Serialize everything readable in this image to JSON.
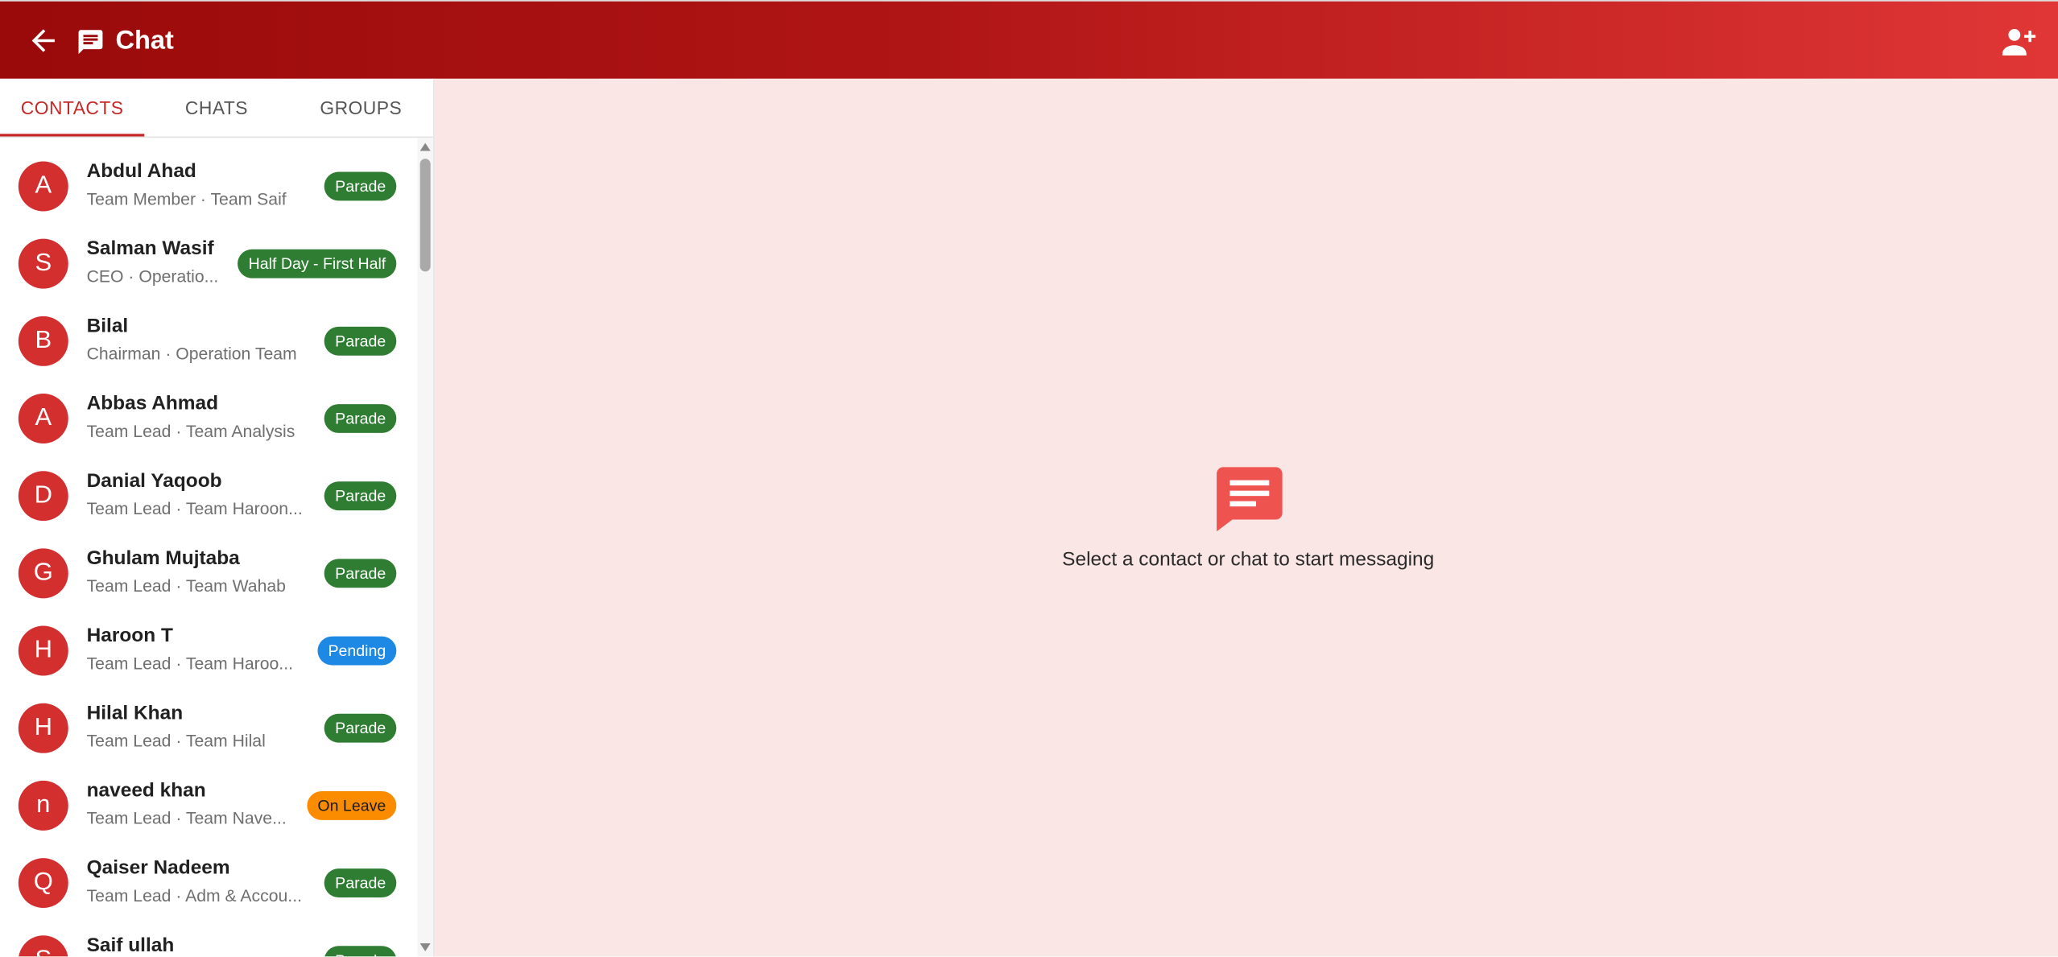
{
  "appbar": {
    "title": "Chat",
    "back_icon": "arrow-left-icon",
    "title_icon": "chat-bubble-icon",
    "action_icon": "add-person-icon",
    "colors": {
      "gradient_start": "#9a0a0a",
      "gradient_end": "#e03636"
    }
  },
  "tabs": [
    {
      "label": "CONTACTS",
      "active": true
    },
    {
      "label": "CHATS",
      "active": false
    },
    {
      "label": "GROUPS",
      "active": false
    }
  ],
  "contacts": [
    {
      "initial": "A",
      "name": "Abdul Ahad",
      "sub": "Team Member · Team Saif",
      "status": "Parade",
      "status_color": "#2e7d32"
    },
    {
      "initial": "S",
      "name": "Salman Wasif",
      "sub": "CEO · Operatio...",
      "status": "Half Day - First Half",
      "status_color": "#2e7d32"
    },
    {
      "initial": "B",
      "name": "Bilal",
      "sub": "Chairman · Operation Team",
      "status": "Parade",
      "status_color": "#2e7d32"
    },
    {
      "initial": "A",
      "name": "Abbas Ahmad",
      "sub": "Team Lead · Team Analysis",
      "status": "Parade",
      "status_color": "#2e7d32"
    },
    {
      "initial": "D",
      "name": "Danial Yaqoob",
      "sub": "Team Lead · Team Haroon...",
      "status": "Parade",
      "status_color": "#2e7d32"
    },
    {
      "initial": "G",
      "name": "Ghulam Mujtaba",
      "sub": "Team Lead · Team Wahab",
      "status": "Parade",
      "status_color": "#2e7d32"
    },
    {
      "initial": "H",
      "name": "Haroon T",
      "sub": "Team Lead · Team Haroo...",
      "status": "Pending",
      "status_color": "#1e88e5"
    },
    {
      "initial": "H",
      "name": "Hilal Khan",
      "sub": "Team Lead · Team Hilal",
      "status": "Parade",
      "status_color": "#2e7d32"
    },
    {
      "initial": "n",
      "name": "naveed khan",
      "sub": "Team Lead · Team Nave...",
      "status": "On Leave",
      "status_color": "#fb8c00"
    },
    {
      "initial": "Q",
      "name": "Qaiser Nadeem",
      "sub": "Team Lead · Adm & Accou...",
      "status": "Parade",
      "status_color": "#2e7d32"
    },
    {
      "initial": "S",
      "name": "Saif ullah",
      "sub": "",
      "status": "Parade",
      "status_color": "#2e7d32"
    }
  ],
  "main": {
    "empty_icon": "message-icon",
    "empty_text": "Select a contact or chat to start messaging"
  }
}
